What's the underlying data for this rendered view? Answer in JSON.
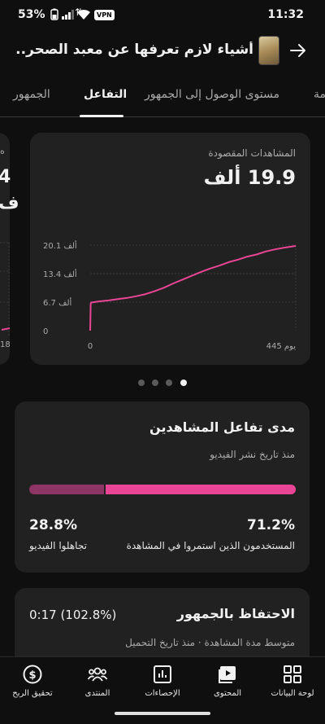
{
  "status_bar": {
    "battery_percent": "53%",
    "vpn": "VPN",
    "time": "11:32"
  },
  "header": {
    "title": "أشياء لازم تعرفها عن معبد الصحر..",
    "back_icon": "arrow-right-icon",
    "thumbnail_icon": "video-thumbnail"
  },
  "tabs": [
    {
      "label": "مة"
    },
    {
      "label": "مستوى الوصول إلى الجمهور"
    },
    {
      "label": "التفاعل",
      "active": true
    },
    {
      "label": "الجمهور"
    }
  ],
  "chart_card": {
    "label": "المشاهدات المقصودة",
    "value": "19.9 ألف",
    "peek_text": "4\nف",
    "peek_label": "ه"
  },
  "chart_data": {
    "type": "line",
    "title": "",
    "xlabel": "",
    "ylabel": "",
    "x_tick_labels": [
      "0",
      "445 يوم"
    ],
    "y_tick_labels": [
      "0",
      "6.7 ألف",
      "13.4 ألف",
      "20.1 ألف"
    ],
    "xlim": [
      0,
      445
    ],
    "ylim": [
      0,
      20.1
    ],
    "series": [
      {
        "color": "#e94595",
        "x": [
          0,
          1,
          2,
          20,
          40,
          60,
          80,
          100,
          120,
          140,
          160,
          180,
          200,
          220,
          240,
          260,
          280,
          300,
          320,
          340,
          360,
          380,
          400,
          420,
          445
        ],
        "y": [
          0,
          6.3,
          6.6,
          6.9,
          7.1,
          7.4,
          7.7,
          8.1,
          8.6,
          9.3,
          10.1,
          11.1,
          12.0,
          12.9,
          13.8,
          14.6,
          15.3,
          16.1,
          16.7,
          17.4,
          17.9,
          18.6,
          19.1,
          19.5,
          19.9
        ]
      }
    ],
    "grid": true
  },
  "pager": {
    "count": 4,
    "active_index": 3
  },
  "engagement": {
    "title": "مدى تفاعل المشاهدين",
    "subtitle": "منذ تاريخ نشر الفيديو",
    "stayed_pct": "71.2%",
    "stayed_label": "المستخدمون الذين استمروا في المشاهدة",
    "skipped_pct": "28.8%",
    "skipped_label": "تجاهلوا الفيديو",
    "stayed_fraction": 0.712,
    "colors": {
      "stayed": "#e94595",
      "skipped": "#8d3565"
    }
  },
  "retention": {
    "title": "الاحتفاظ بالجمهور",
    "value": "0:17 (102.8%)",
    "subtitle": "متوسط مدة المشاهدة · منذ تاريخ التحميل"
  },
  "bottom_nav": [
    {
      "label": "لوحة البيانات",
      "icon": "dashboard-icon"
    },
    {
      "label": "المحتوى",
      "icon": "content-icon"
    },
    {
      "label": "الإحصاءات",
      "icon": "analytics-icon"
    },
    {
      "label": "المنتدى",
      "icon": "community-icon"
    },
    {
      "label": "تحقيق الربح",
      "icon": "earn-icon"
    }
  ]
}
